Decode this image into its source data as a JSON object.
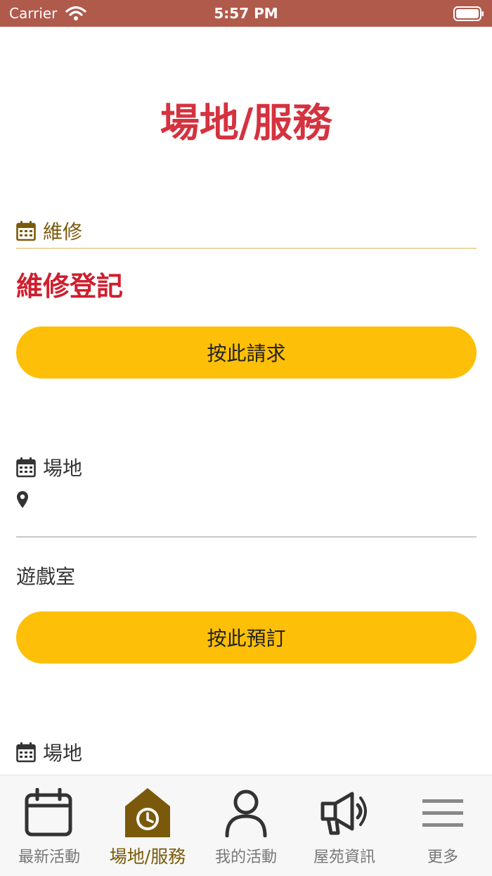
{
  "status_bar": {
    "carrier": "Carrier",
    "time": "5:57 PM"
  },
  "page": {
    "title": "場地/服務"
  },
  "repair_section": {
    "heading": "維修",
    "item_title": "維修登記",
    "button_label": "按此請求"
  },
  "venue_sections": [
    {
      "heading": "場地",
      "venue_name": "遊戲室",
      "button_label": "按此預訂"
    },
    {
      "heading": "場地"
    }
  ],
  "tab_bar": {
    "active_index": 1,
    "tabs": [
      {
        "label": "最新活動",
        "icon": "calendar-icon"
      },
      {
        "label": "場地/服務",
        "icon": "house-clock-icon"
      },
      {
        "label": "我的活動",
        "icon": "person-icon"
      },
      {
        "label": "屋苑資訊",
        "icon": "megaphone-icon"
      },
      {
        "label": "更多",
        "icon": "menu-icon"
      }
    ]
  },
  "colors": {
    "status_bar": "#b05a4c",
    "title_red": "#d5323f",
    "accent_gold": "#7a5a0a",
    "button_yellow": "#fdbf08"
  }
}
